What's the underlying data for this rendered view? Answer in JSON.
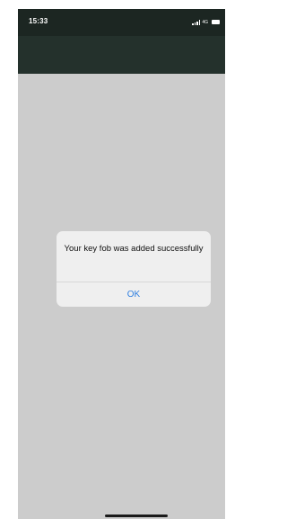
{
  "status_bar": {
    "time": "15:33",
    "network": "4G"
  },
  "dialog": {
    "message": "Your key fob was added successfully",
    "ok_label": "OK"
  },
  "colors": {
    "status_bar": "#1c2622",
    "nav_bar": "#24312c",
    "background": "#cccccc",
    "alert": "#efefef",
    "accent": "#2f7fe0"
  }
}
